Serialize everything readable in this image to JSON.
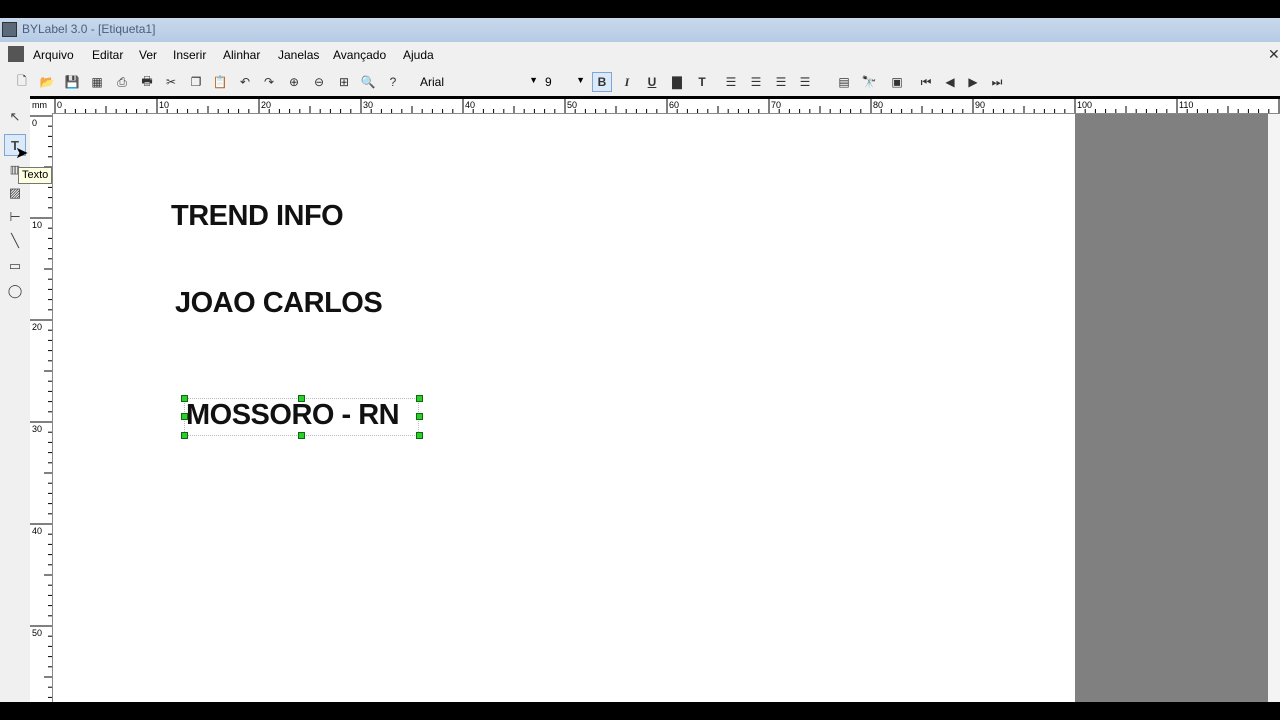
{
  "window": {
    "title": "BYLabel 3.0 - [Etiqueta1]"
  },
  "menu": [
    "Arquivo",
    "Editar",
    "Ver",
    "Inserir",
    "Alinhar",
    "Janelas",
    "Avançado",
    "Ajuda"
  ],
  "toolbar": {
    "font_name": "Arial",
    "font_size": "9",
    "icons": [
      "new-icon",
      "open-icon",
      "save-icon",
      "print-icon",
      "print-preview-icon",
      "printer-icon",
      "cut-icon",
      "copy-icon",
      "paste-icon",
      "undo-icon",
      "redo-icon",
      "zoom-in-icon",
      "zoom-out-icon",
      "zoom-fit-icon",
      "zoom-icon",
      "help-icon"
    ],
    "format_icons": [
      "bold-icon",
      "italic-icon",
      "underline-icon",
      "text-box-icon",
      "text-format-icon",
      "align-left-icon",
      "align-center-icon",
      "align-right-icon",
      "justify-icon"
    ],
    "nav_icons": [
      "database-icon",
      "find-icon",
      "record-icon",
      "first-icon",
      "prev-icon",
      "next-icon",
      "last-icon"
    ]
  },
  "left_tools": [
    "pointer-icon",
    "text-icon",
    "barcode-icon",
    "image-icon",
    "line-h-icon",
    "line-icon",
    "rectangle-icon",
    "ellipse-icon"
  ],
  "tooltip": "Texto",
  "ruler": {
    "unit": "mm",
    "h_marks": [
      "0",
      "10",
      "20",
      "30",
      "40",
      "50",
      "60",
      "70",
      "80",
      "90",
      "100",
      "110"
    ],
    "v_marks": [
      "0",
      "10",
      "20",
      "30",
      "40",
      "50"
    ]
  },
  "label": {
    "line1": "TREND INFO",
    "line2": "JOAO CARLOS",
    "line3": "MOSSORO - RN"
  },
  "colors": {
    "selection_handle": "#2ecc2e",
    "workspace": "#808080"
  }
}
